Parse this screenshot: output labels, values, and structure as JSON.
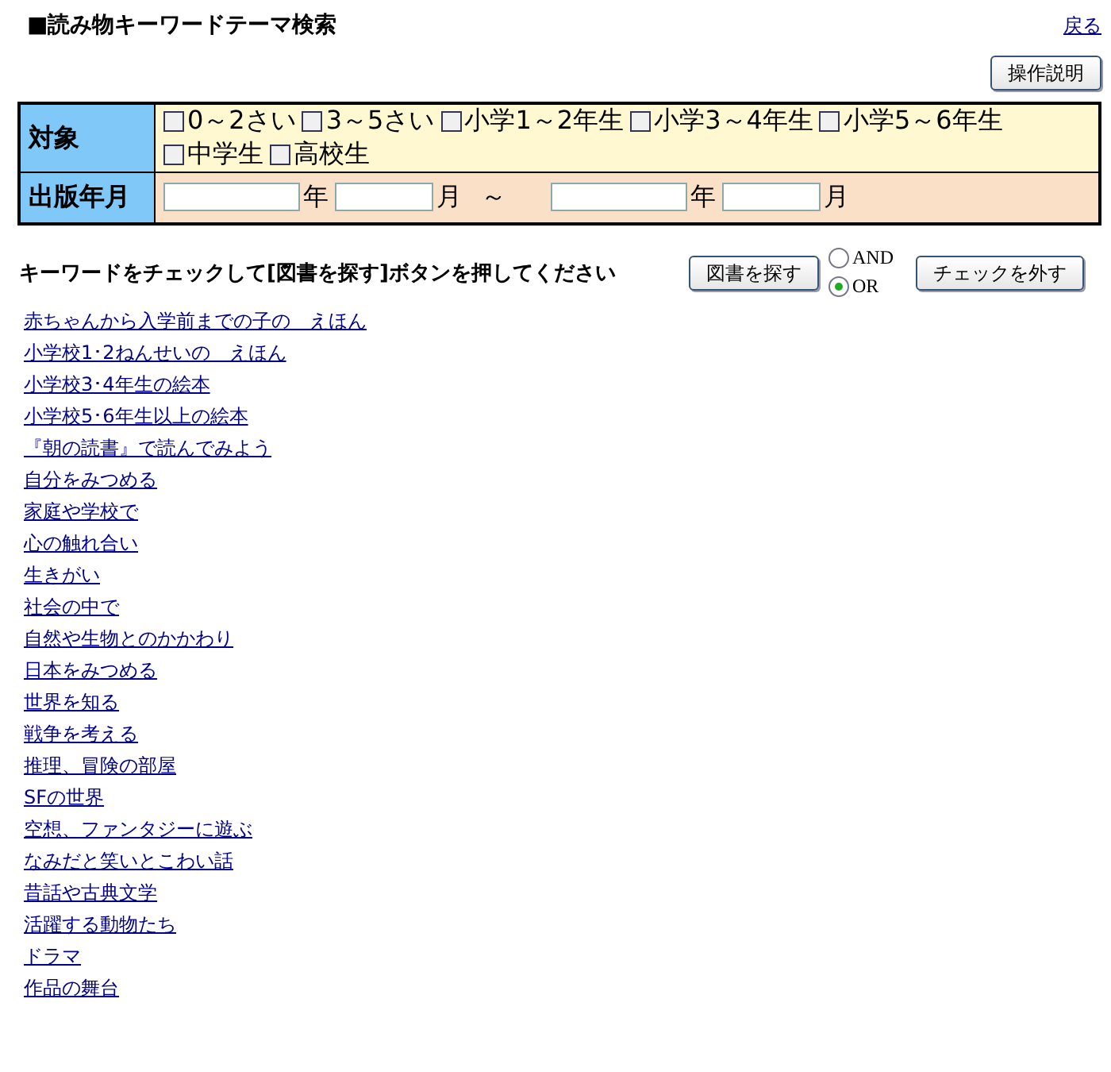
{
  "header": {
    "title": "■読み物キーワードテーマ検索",
    "back_link": "戻る",
    "help_button": "操作説明"
  },
  "filters": {
    "target": {
      "label": "対象",
      "options": [
        {
          "label": "0～2さい",
          "checked": false
        },
        {
          "label": "3～5さい",
          "checked": false
        },
        {
          "label": "小学1～2年生",
          "checked": false
        },
        {
          "label": "小学3～4年生",
          "checked": false
        },
        {
          "label": "小学5～6年生",
          "checked": false
        },
        {
          "label": "中学生",
          "checked": false
        },
        {
          "label": "高校生",
          "checked": false
        }
      ]
    },
    "published": {
      "label": "出版年月",
      "range_separator": "～",
      "from": [
        {
          "unit": "年"
        },
        {
          "unit": "月"
        }
      ],
      "to": [
        {
          "unit": "年"
        },
        {
          "unit": "月"
        }
      ]
    }
  },
  "instruction": "キーワードをチェックして[図書を探す]ボタンを押してください",
  "search_button": "図書を探す",
  "logic": [
    {
      "label": "AND",
      "selected": false
    },
    {
      "label": "OR",
      "selected": true
    }
  ],
  "clear_button": "チェックを外す",
  "themes": [
    "赤ちゃんから入学前までの子の　えほん",
    "小学校1･2ねんせいの　えほん",
    "小学校3･4年生の絵本",
    "小学校5･6年生以上の絵本",
    "『朝の読書』で読んでみよう",
    "自分をみつめる",
    "家庭や学校で",
    "心の触れ合い",
    "生きがい",
    "社会の中で",
    "自然や生物とのかかわり",
    "日本をみつめる",
    "世界を知る",
    "戦争を考える",
    "推理、冒険の部屋",
    "SFの世界",
    "空想、ファンタジーに遊ぶ",
    "なみだと笑いとこわい話",
    "昔話や古典文学",
    "活躍する動物たち",
    "ドラマ",
    "作品の舞台"
  ]
}
